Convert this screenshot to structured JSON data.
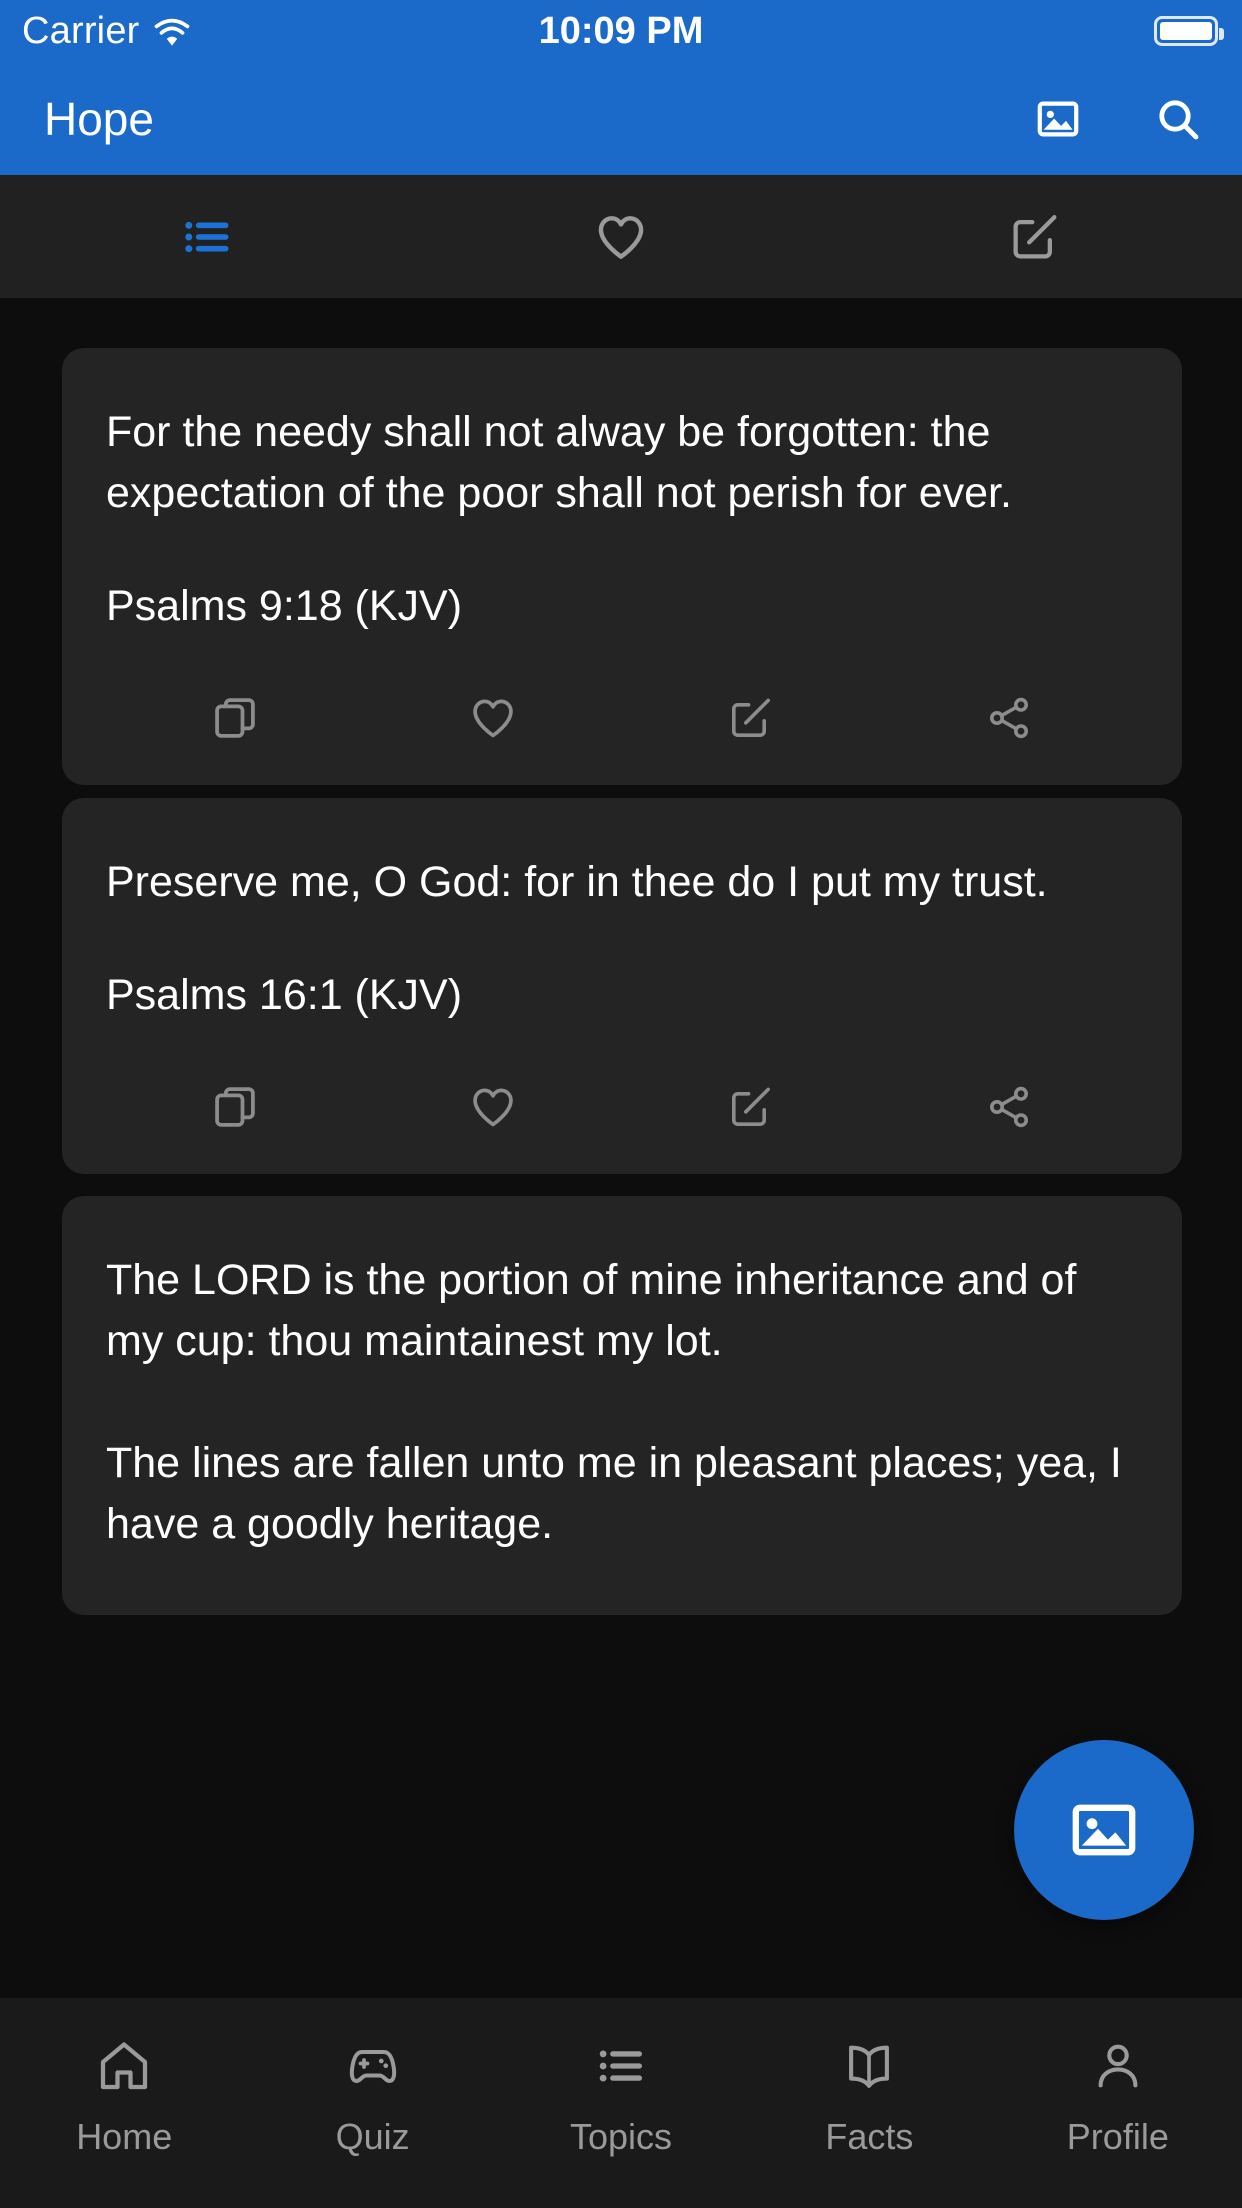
{
  "status_bar": {
    "carrier": "Carrier",
    "wifi_icon": "wifi-icon",
    "time": "10:09 PM",
    "battery_icon": "battery-full-icon"
  },
  "header": {
    "title": "Hope",
    "actions": [
      {
        "icon": "image-icon",
        "name": "image-action"
      },
      {
        "icon": "search-icon",
        "name": "search-action"
      }
    ]
  },
  "segmented_tabs": {
    "active_index": 0,
    "active_color": "#1b73d8",
    "inactive_color": "#9a9a9a",
    "items": [
      {
        "icon": "list-icon",
        "name": "tab-list"
      },
      {
        "icon": "heart-icon",
        "name": "tab-favorites"
      },
      {
        "icon": "compose-icon",
        "name": "tab-notes"
      }
    ]
  },
  "cards": [
    {
      "text": "For the needy shall not alway be forgotten: the expectation of the poor shall not perish for ever.",
      "reference": "Psalms 9:18 (KJV)",
      "actions": [
        "copy-icon",
        "heart-icon",
        "compose-icon",
        "share-icon"
      ]
    },
    {
      "text": "Preserve me, O God: for in thee do I put my trust.",
      "reference": "Psalms 16:1 (KJV)",
      "actions": [
        "copy-icon",
        "heart-icon",
        "compose-icon",
        "share-icon"
      ]
    },
    {
      "text": "The LORD is the portion of mine inheritance and of my cup: thou maintainest my lot.\n\nThe lines are fallen unto me in pleasant places; yea, I have a goodly heritage.",
      "reference": "",
      "actions": []
    }
  ],
  "fab": {
    "icon": "image-icon",
    "name": "create-image-fab",
    "color": "#1b6ac9"
  },
  "bottom_nav": {
    "items": [
      {
        "label": "Home",
        "icon": "home-icon"
      },
      {
        "label": "Quiz",
        "icon": "gamepad-icon"
      },
      {
        "label": "Topics",
        "icon": "list-icon"
      },
      {
        "label": "Facts",
        "icon": "book-icon"
      },
      {
        "label": "Profile",
        "icon": "person-icon"
      }
    ]
  },
  "colors": {
    "brand_blue": "#1b6ac9",
    "card_bg": "#242424",
    "page_bg": "#0d0d0d",
    "tabstrip_bg": "#212121",
    "bottomnav_bg": "#1a1a1a"
  }
}
